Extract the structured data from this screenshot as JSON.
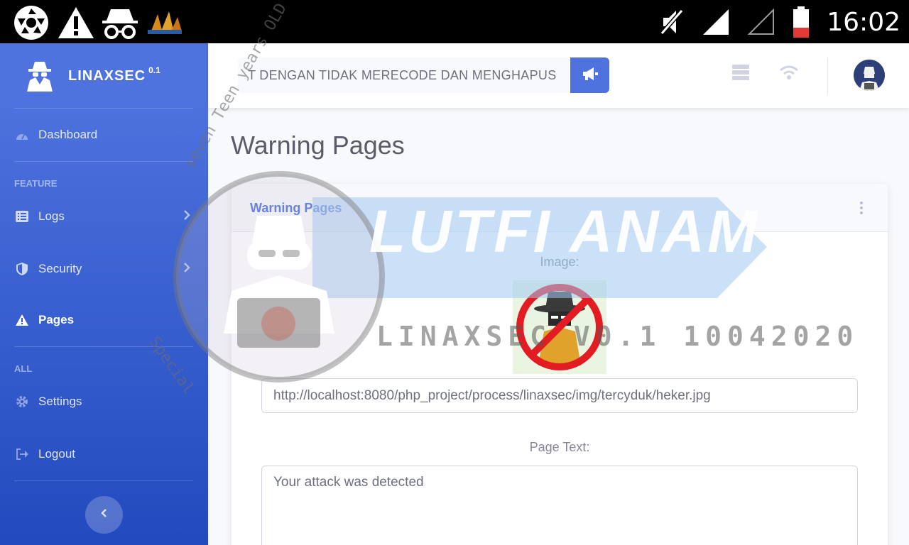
{
  "status_bar": {
    "time": "16:02",
    "icons": [
      "shutter-icon",
      "warning-icon",
      "incognito-icon",
      "app-badge-icon",
      "mute-icon",
      "signal-full-icon",
      "signal-empty-icon",
      "battery-low-icon"
    ]
  },
  "sidebar": {
    "brand": "LINAXSEC",
    "version": "0.1",
    "items": [
      {
        "label": "Dashboard",
        "icon": "tachometer-icon"
      },
      {
        "label": "Logs",
        "icon": "list-icon"
      },
      {
        "label": "Security",
        "icon": "shield-icon"
      },
      {
        "label": "Pages",
        "icon": "warning-icon"
      },
      {
        "label": "Settings",
        "icon": "gear-icon"
      },
      {
        "label": "Logout",
        "icon": "sign-out-icon"
      }
    ],
    "headings": {
      "feature": "FEATURE",
      "all": "ALL"
    },
    "accent": "#4e73df"
  },
  "topbar": {
    "search_value": "T DENGAN TIDAK MERECODE DAN MENGHAPUS",
    "icons": [
      "megaphone-icon",
      "server-icon",
      "wifi-icon",
      "avatar"
    ]
  },
  "page": {
    "title": "Warning Pages",
    "card_title": "Warning Pages",
    "image_label": "Image:",
    "image_url": "http://localhost:8080/php_project/process/linaxsec/img/tercyduk/heker.jpg",
    "text_label": "Page Text:",
    "text_value": "Your attack was detected"
  },
  "watermark": {
    "banner": "LUTFI ANAM",
    "sub": "LINAXSEC V0.1 10042020",
    "ring_top": "seven Teen years OLD",
    "ring_bottom": "Special"
  }
}
